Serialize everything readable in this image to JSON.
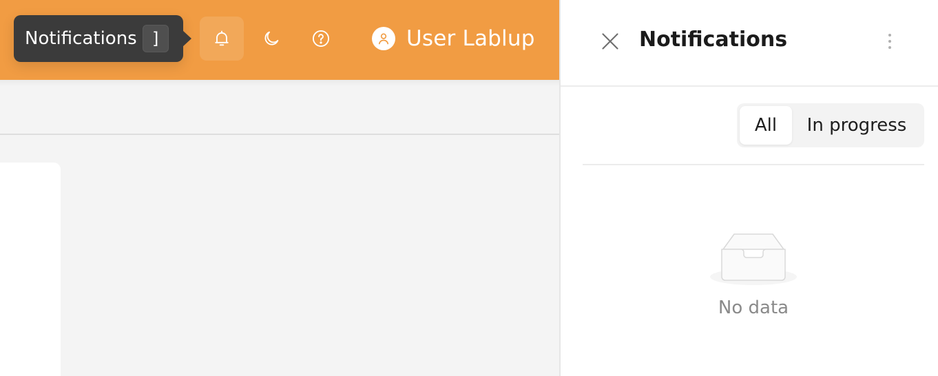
{
  "header": {
    "accent_color": "#f19c43",
    "icons": [
      "bell-icon",
      "moon-icon",
      "question-circle-icon"
    ],
    "user": {
      "name": "User Lablup",
      "icon": "user-icon"
    }
  },
  "tooltip": {
    "label": "Notifications",
    "shortcut": "]"
  },
  "drawer": {
    "title": "Notifications",
    "close_icon": "close-icon",
    "more_icon": "more-vertical-icon",
    "tabs": [
      {
        "label": "All",
        "selected": true
      },
      {
        "label": "In progress",
        "selected": false
      }
    ],
    "empty": {
      "text": "No data",
      "icon": "empty-inbox-icon"
    }
  }
}
